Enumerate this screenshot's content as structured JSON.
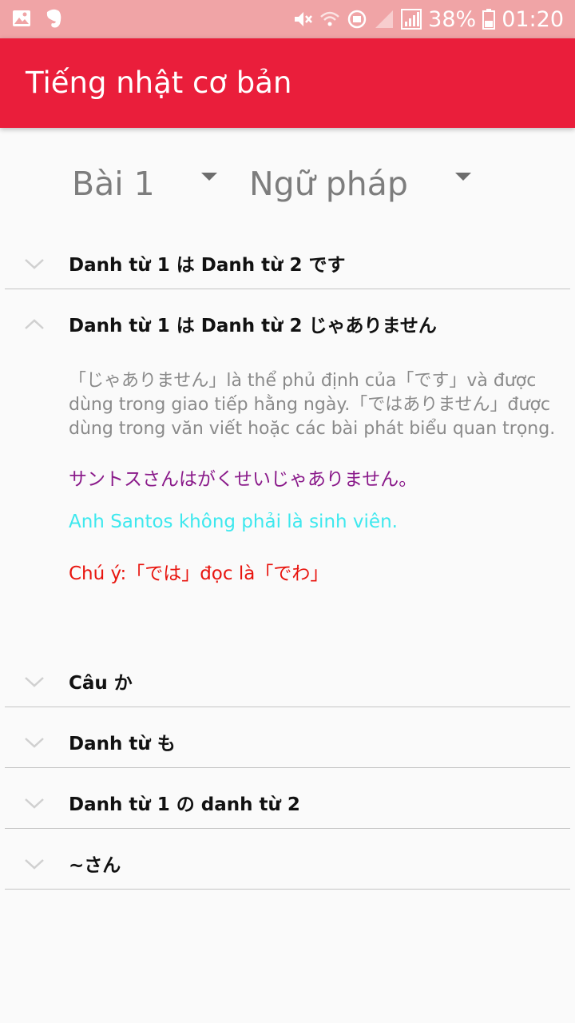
{
  "status_bar": {
    "battery": "38%",
    "time": "01:20",
    "icons": [
      "gallery-icon",
      "evernote-icon",
      "mute-icon",
      "wifi-icon",
      "vpn-icon",
      "signal-weak-icon",
      "signal-icon",
      "battery-icon"
    ]
  },
  "app_bar": {
    "title": "Tiếng nhật cơ bản"
  },
  "spinners": {
    "lesson": "Bài 1",
    "category": "Ngữ pháp"
  },
  "groups": [
    {
      "title": "Danh từ 1 は Danh từ 2 です",
      "expanded": false
    },
    {
      "title": "Danh từ 1 は Danh từ 2 じゃありません",
      "expanded": true
    },
    {
      "title": "Câu か",
      "expanded": false
    },
    {
      "title": "Danh từ も",
      "expanded": false
    },
    {
      "title": "Danh từ 1 の danh từ 2",
      "expanded": false
    },
    {
      "title": "~さん",
      "expanded": false
    }
  ],
  "detail": {
    "explanation": "「じゃありません」là thể phủ định của「です」và được dùng trong giao tiếp hằng ngày.「ではありません」được dùng trong văn viết hoặc các bài phát biểu quan trọng.",
    "example_jp": "サントスさんはがくせいじゃありません。",
    "example_vi": "Anh Santos không phải là sinh viên.",
    "note": "Chú ý:「では」đọc là「でわ」"
  },
  "colors": {
    "status_bar": "#f0a4a6",
    "app_bar": "#ea1e3b",
    "example_jp": "#8a1a8a",
    "example_vi": "#3de8ee",
    "note": "#e8140e"
  }
}
